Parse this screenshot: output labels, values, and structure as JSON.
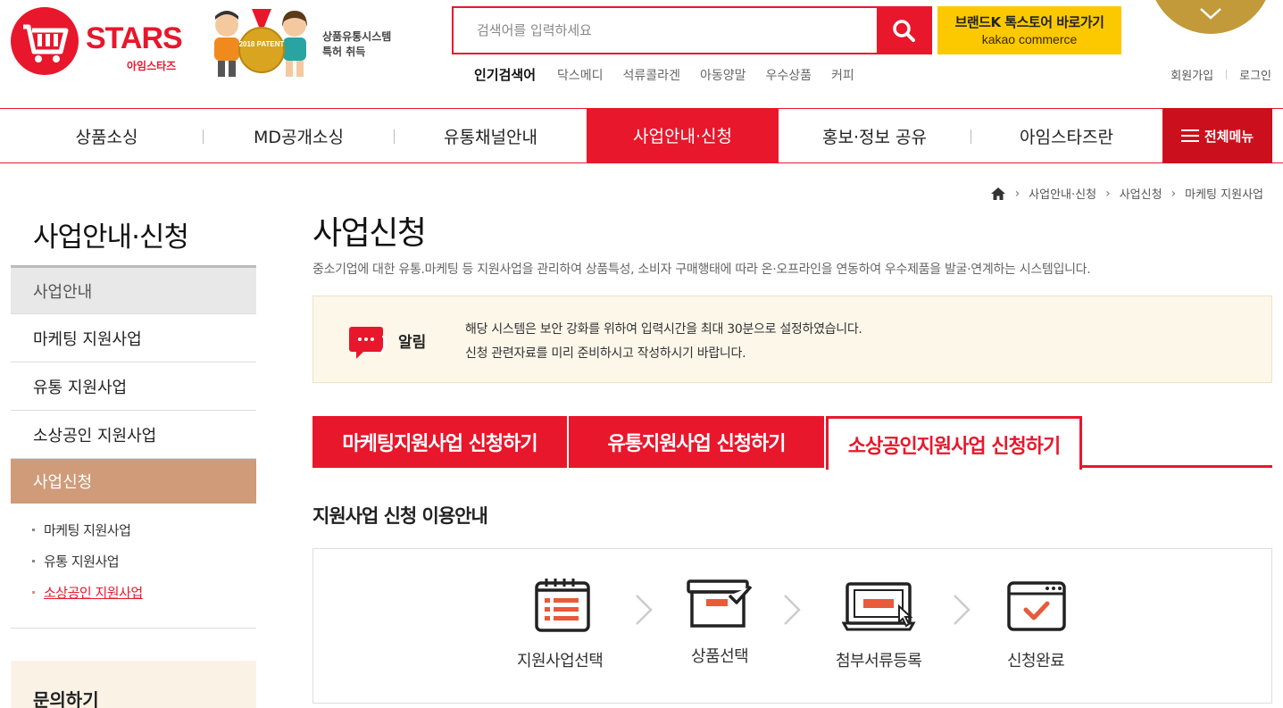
{
  "header": {
    "logo_text": "STARS",
    "logo_sub": "아임스타즈",
    "patent_badge": "2018 PATENT",
    "patent_line1": "상품유통시스템",
    "patent_line2": "특허 취득",
    "search_placeholder": "검색어를 입력하세요",
    "kakao_title": "브랜드K 톡스토어 바로가기",
    "kakao_sub": "kakao commerce",
    "popular_title": "인기검색어",
    "popular_keywords": [
      "닥스메디",
      "석류콜라겐",
      "아동양말",
      "우수상품",
      "커피"
    ],
    "member_links": [
      "회원가입",
      "로그인"
    ]
  },
  "gnb": {
    "items": [
      "상품소싱",
      "MD공개소싱",
      "유통채널안내",
      "사업안내·신청",
      "홍보·정보 공유",
      "아임스타즈란"
    ],
    "all_menu": "전체메뉴"
  },
  "breadcrumb": [
    "사업안내·신청",
    "사업신청",
    "마케팅 지원사업"
  ],
  "sidebar": {
    "title": "사업안내·신청",
    "items": [
      "사업안내",
      "마케팅 지원사업",
      "유통 지원사업",
      "소상공인 지원사업",
      "사업신청"
    ],
    "sub_items": [
      "마케팅 지원사업",
      "유통 지원사업",
      "소상공인 지원사업"
    ],
    "contact_title": "문의하기"
  },
  "main": {
    "title": "사업신청",
    "description": "중소기업에 대한 유통.마케팅 등 지원사업을 관리하여 상품특성, 소비자 구매행태에 따라 온·오프라인을 연동하여 우수제품을 발굴·연계하는 시스템입니다.",
    "notice_label": "알림",
    "notice_line1": "해당 시스템은 보안 강화를 위하여 입력시간을 최대 30분으로 설정하였습니다.",
    "notice_line2": "신청 관련자료를 미리 준비하시고 작성하시기 바랍니다.",
    "tabs": [
      "마케팅지원사업 신청하기",
      "유통지원사업 신청하기",
      "소상공인지원사업 신청하기"
    ],
    "guide_title": "지원사업 신청 이용안내",
    "steps": [
      "지원사업선택",
      "상품선택",
      "첨부서류등록",
      "신청완료"
    ]
  },
  "colors": {
    "brand_red": "#e8172c",
    "kakao_yellow": "#fcc800",
    "side_active": "#cf9b79",
    "notice_bg": "#fdf7ea",
    "badge_gold": "#c29a3a"
  }
}
